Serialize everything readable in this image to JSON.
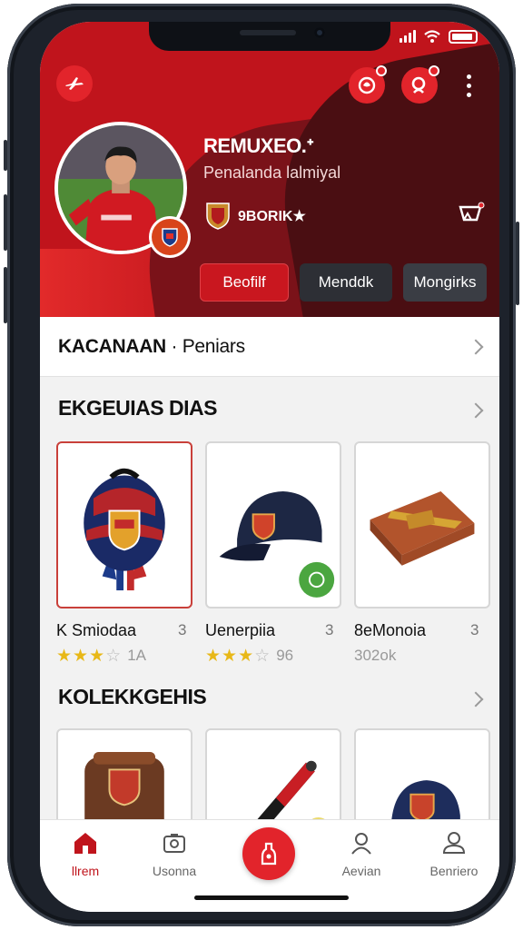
{
  "header": {
    "profile_name": "REMUXEO.ᐩ",
    "profile_subtitle": "Penalanda lalmiyal",
    "badge_text": "9BORIK★",
    "buttons": [
      {
        "label": "Beofilf"
      },
      {
        "label": "Menddk"
      },
      {
        "label": "Mongirks"
      }
    ],
    "icons": {
      "left": "plane-icon",
      "notifications": "notification-icon",
      "search": "search-icon",
      "menu": "more-vertical-icon",
      "cart": "cart-icon"
    }
  },
  "link_row": {
    "bold": "KACANAAN",
    "rest": " · Peniars"
  },
  "featured": {
    "title": "EKGEUIAS DIAS",
    "items": [
      {
        "name": "K Smiodaa",
        "num": "3",
        "stars": 3.5,
        "rating_text": "1A"
      },
      {
        "name": "Uenerpiia",
        "num": "3",
        "stars": 3.5,
        "rating_text": "96"
      },
      {
        "name": "8eMonoia",
        "num": "3",
        "rating_text": "302ok"
      }
    ]
  },
  "collections": {
    "title": "KOLEKKGEHIS"
  },
  "tabbar": {
    "tabs": [
      {
        "label": "llrem",
        "icon": "home-icon"
      },
      {
        "label": "Usonna",
        "icon": "camera-icon"
      },
      {
        "label": "Aevian",
        "icon": "user-icon"
      },
      {
        "label": "Benriero",
        "icon": "profile-icon"
      }
    ],
    "fab_icon": "add-item-icon"
  },
  "colors": {
    "brand_red": "#c0141c",
    "dark_red": "#4a0e12",
    "star": "#e8b818"
  }
}
